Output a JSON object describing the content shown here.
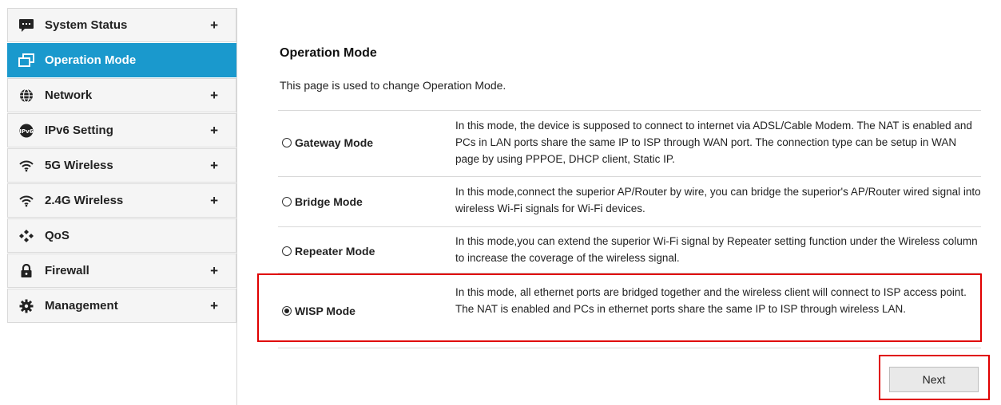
{
  "sidebar": {
    "items": [
      {
        "label": "System Status",
        "icon": "chat-bubble-icon",
        "expandable": true,
        "active": false
      },
      {
        "label": "Operation Mode",
        "icon": "window-icon",
        "expandable": false,
        "active": true
      },
      {
        "label": "Network",
        "icon": "globe-icon",
        "expandable": true,
        "active": false
      },
      {
        "label": "IPv6 Setting",
        "icon": "ipv6-icon",
        "expandable": true,
        "active": false
      },
      {
        "label": "5G Wireless",
        "icon": "wifi-icon",
        "expandable": true,
        "active": false
      },
      {
        "label": "2.4G Wireless",
        "icon": "wifi-icon",
        "expandable": true,
        "active": false
      },
      {
        "label": "QoS",
        "icon": "qos-icon",
        "expandable": false,
        "active": false
      },
      {
        "label": "Firewall",
        "icon": "lock-icon",
        "expandable": true,
        "active": false
      },
      {
        "label": "Management",
        "icon": "gear-icon",
        "expandable": true,
        "active": false
      }
    ],
    "expand_symbol": "+"
  },
  "main": {
    "title": "Operation Mode",
    "description": "This page is used to change Operation Mode.",
    "modes": [
      {
        "label": "Gateway Mode",
        "checked": false,
        "description": "In this mode, the device is supposed to connect to internet via ADSL/Cable Modem. The NAT is enabled and PCs in LAN ports share the same IP to ISP through WAN port. The connection type can be setup in WAN page by using PPPOE, DHCP client, Static IP."
      },
      {
        "label": "Bridge Mode",
        "checked": false,
        "description": "In this mode,connect the superior AP/Router by wire, you can bridge the superior's AP/Router wired signal into wireless Wi-Fi signals for Wi-Fi devices."
      },
      {
        "label": "Repeater Mode",
        "checked": false,
        "description": "In this mode,you can extend the superior Wi-Fi signal by Repeater setting function under the Wireless column to increase the coverage of the wireless signal."
      },
      {
        "label": "WISP Mode",
        "checked": true,
        "description": "In this mode, all ethernet ports are bridged together and the wireless client will connect to ISP access point. The NAT is enabled and PCs in ethernet ports share the same IP to ISP through wireless LAN."
      }
    ],
    "next_label": "Next"
  },
  "colors": {
    "active_bg": "#1a99cd",
    "highlight": "#e00000"
  }
}
